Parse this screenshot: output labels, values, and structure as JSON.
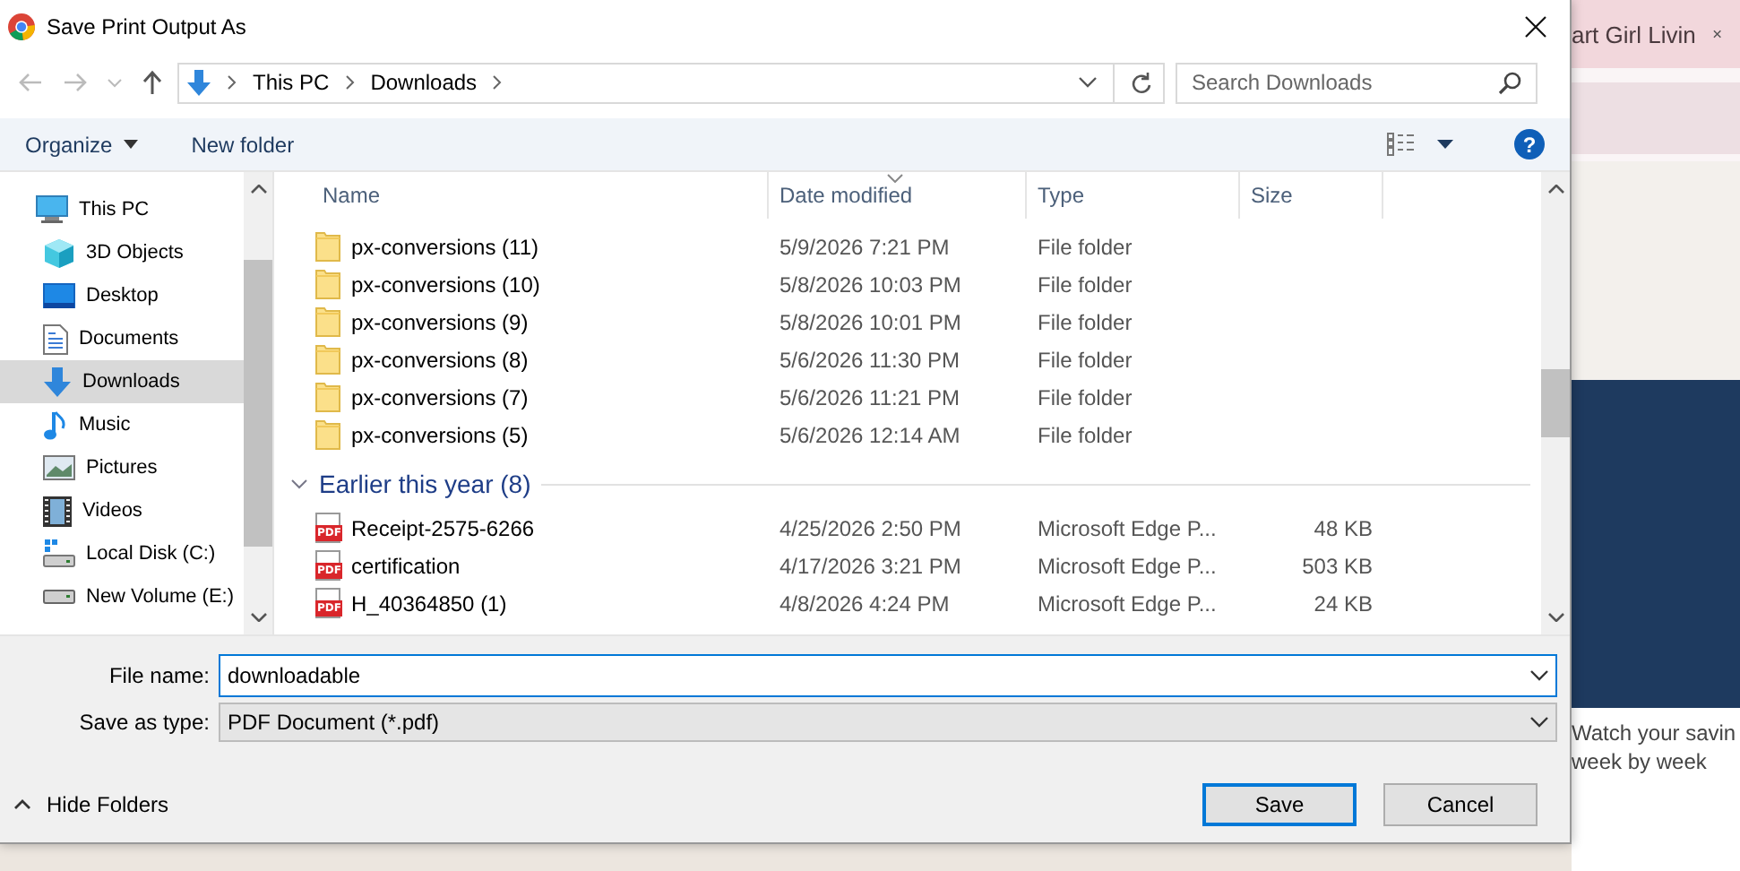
{
  "window": {
    "title": "Save Print Output As"
  },
  "address": {
    "crumbs": [
      "This PC",
      "Downloads"
    ]
  },
  "search": {
    "placeholder": "Search Downloads"
  },
  "toolbar": {
    "organize": "Organize",
    "new_folder": "New folder",
    "help": "?"
  },
  "sidebar": {
    "items": [
      {
        "label": "This PC",
        "kind": "pc",
        "selected": false,
        "children": [
          {
            "label": "3D Objects",
            "kind": "cube",
            "selected": false
          },
          {
            "label": "Desktop",
            "kind": "desktop",
            "selected": false
          },
          {
            "label": "Documents",
            "kind": "documents",
            "selected": false
          },
          {
            "label": "Downloads",
            "kind": "downloads",
            "selected": true
          },
          {
            "label": "Music",
            "kind": "music",
            "selected": false
          },
          {
            "label": "Pictures",
            "kind": "pictures",
            "selected": false
          },
          {
            "label": "Videos",
            "kind": "videos",
            "selected": false
          },
          {
            "label": "Local Disk (C:)",
            "kind": "disk",
            "selected": false
          },
          {
            "label": "New Volume (E:)",
            "kind": "drive",
            "selected": false
          }
        ]
      }
    ]
  },
  "columns": [
    "Name",
    "Date modified",
    "Type",
    "Size"
  ],
  "sections": [
    {
      "rows": [
        {
          "kind": "folder",
          "name": "px-conversions (11)",
          "date": "5/9/2026 7:21 PM",
          "type": "File folder"
        },
        {
          "kind": "folder",
          "name": "px-conversions (10)",
          "date": "5/8/2026 10:03 PM",
          "type": "File folder"
        },
        {
          "kind": "folder",
          "name": "px-conversions (9)",
          "date": "5/8/2026 10:01 PM",
          "type": "File folder"
        },
        {
          "kind": "folder",
          "name": "px-conversions (8)",
          "date": "5/6/2026 11:30 PM",
          "type": "File folder"
        },
        {
          "kind": "folder",
          "name": "px-conversions (7)",
          "date": "5/6/2026 11:21 PM",
          "type": "File folder"
        },
        {
          "kind": "folder",
          "name": "px-conversions (5)",
          "date": "5/6/2026 12:14 AM",
          "type": "File folder"
        }
      ]
    },
    {
      "title": "Earlier this year (8)",
      "expanded": true,
      "rows": [
        {
          "kind": "pdf",
          "badge": "PDF",
          "name": "Receipt-2575-6266",
          "date": "4/25/2026 2:50 PM",
          "type": "Microsoft Edge P...",
          "size": "48 KB"
        },
        {
          "kind": "pdf",
          "badge": "PDF",
          "name": "certification",
          "date": "4/17/2026 3:21 PM",
          "type": "Microsoft Edge P...",
          "size": "503 KB"
        },
        {
          "kind": "pdf",
          "badge": "PDF",
          "name": "H_40364850 (1)",
          "date": "4/8/2026 4:24 PM",
          "type": "Microsoft Edge P...",
          "size": "24 KB"
        }
      ]
    }
  ],
  "file_name": {
    "label": "File name:",
    "value": "downloadable"
  },
  "save_type": {
    "label": "Save as type:",
    "value": "PDF Document (*.pdf)"
  },
  "hide_folders": "Hide Folders",
  "buttons": [
    {
      "label": "Save",
      "default": true
    },
    {
      "label": "Cancel",
      "default": false
    }
  ],
  "background": {
    "tab_title": "art Girl Livin",
    "caption": [
      "Watch your savin",
      "week by week"
    ]
  }
}
